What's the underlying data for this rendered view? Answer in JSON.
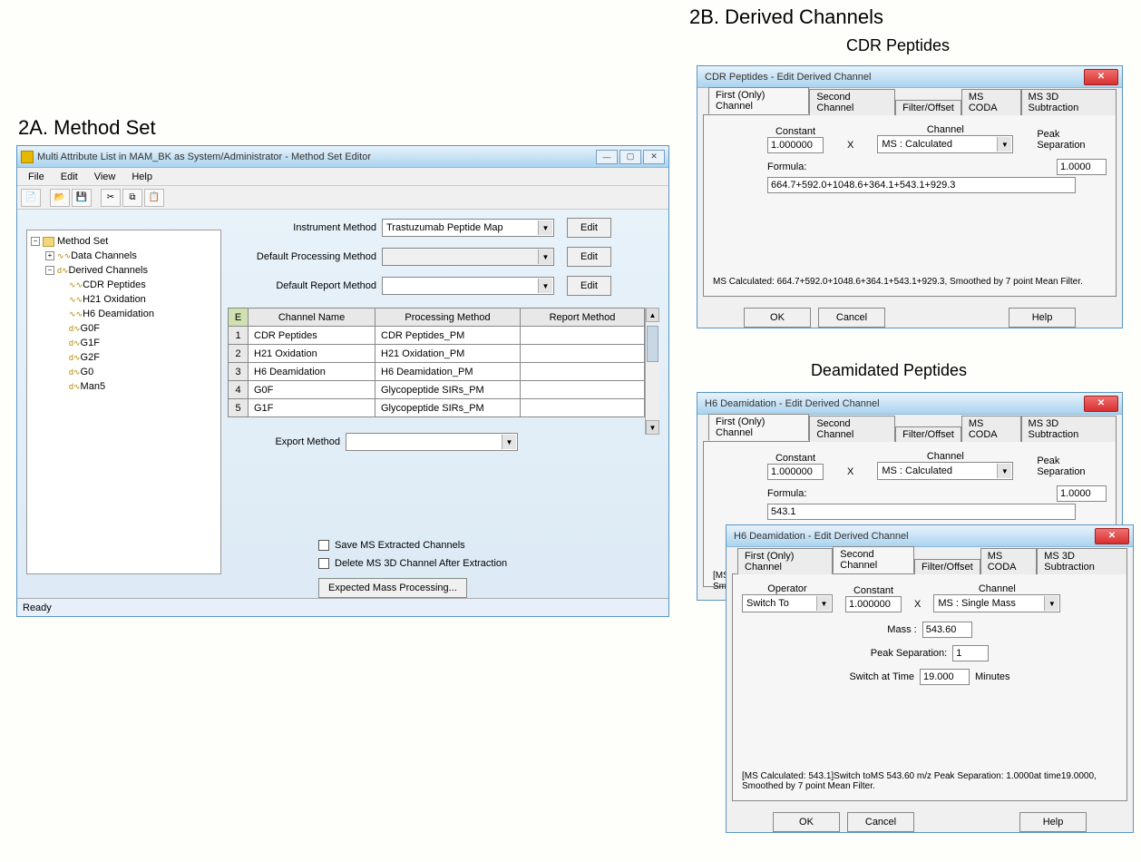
{
  "titles": {
    "sec2A": "2A. Method Set",
    "sec2B": "2B. Derived Channels",
    "sub_cdr": "CDR Peptides",
    "sub_deam": "Deamidated Peptides"
  },
  "window2A": {
    "title": "Multi Attribute List in MAM_BK as System/Administrator - Method Set Editor",
    "menu": {
      "file": "File",
      "edit": "Edit",
      "view": "View",
      "help": "Help"
    },
    "status": "Ready",
    "form": {
      "instrument_label": "Instrument Method",
      "instrument_value": "Trastuzumab Peptide Map",
      "processing_label": "Default Processing Method",
      "processing_value": "",
      "report_label": "Default Report Method",
      "report_value": "",
      "export_label": "Export Method",
      "export_value": "",
      "edit_btn": "Edit",
      "save_ms": "Save MS Extracted Channels",
      "delete_ms": "Delete MS 3D Channel After Extraction",
      "expected_mass": "Expected Mass Processing..."
    },
    "table": {
      "headers": {
        "ch": "Channel Name",
        "pm": "Processing Method",
        "rm": "Report Method"
      },
      "rows": [
        {
          "n": "1",
          "ch": "CDR Peptides",
          "pm": "CDR Peptides_PM",
          "rm": ""
        },
        {
          "n": "2",
          "ch": "H21 Oxidation",
          "pm": "H21 Oxidation_PM",
          "rm": ""
        },
        {
          "n": "3",
          "ch": "H6 Deamidation",
          "pm": "H6 Deamidation_PM",
          "rm": ""
        },
        {
          "n": "4",
          "ch": "G0F",
          "pm": "Glycopeptide SIRs_PM",
          "rm": ""
        },
        {
          "n": "5",
          "ch": "G1F",
          "pm": "Glycopeptide SIRs_PM",
          "rm": ""
        }
      ]
    },
    "tree": {
      "root": "Method Set",
      "data_channels": "Data Channels",
      "derived": "Derived Channels",
      "items": [
        "CDR Peptides",
        "H21 Oxidation",
        "H6 Deamidation",
        "G0F",
        "G1F",
        "G2F",
        "G0",
        "Man5"
      ]
    }
  },
  "dlg_cdr": {
    "title": "CDR Peptides - Edit Derived Channel",
    "tabs": [
      "First (Only) Channel",
      "Second Channel",
      "Filter/Offset",
      "MS CODA",
      "MS 3D Subtraction"
    ],
    "constant_label": "Constant",
    "constant": "1.000000",
    "x": "X",
    "channel_label": "Channel",
    "channel": "MS : Calculated",
    "peak_sep_label": "Peak Separation",
    "peak_sep": "1.0000",
    "formula_label": "Formula:",
    "formula": "664.7+592.0+1048.6+364.1+543.1+929.3",
    "note": "MS Calculated: 664.7+592.0+1048.6+364.1+543.1+929.3, Smoothed by 7 point Mean Filter.",
    "ok": "OK",
    "cancel": "Cancel",
    "help": "Help"
  },
  "dlg_deam1": {
    "title": "H6 Deamidation - Edit Derived Channel",
    "tabs": [
      "First (Only) Channel",
      "Second Channel",
      "Filter/Offset",
      "MS CODA",
      "MS 3D Subtraction"
    ],
    "constant_label": "Constant",
    "constant": "1.000000",
    "x": "X",
    "channel_label": "Channel",
    "channel": "MS : Calculated",
    "peak_sep_label": "Peak Separation",
    "peak_sep": "1.0000",
    "formula_label": "Formula:",
    "formula": "543.1",
    "note_prefix": "[MS",
    "note_prefix2": "Smo"
  },
  "dlg_deam2": {
    "title": "H6 Deamidation - Edit Derived Channel",
    "tabs": [
      "First (Only) Channel",
      "Second Channel",
      "Filter/Offset",
      "MS CODA",
      "MS 3D Subtraction"
    ],
    "operator_label": "Operator",
    "operator": "Switch To",
    "constant_label": "Constant",
    "constant": "1.000000",
    "x": "X",
    "channel_label": "Channel",
    "channel": "MS : Single Mass",
    "mass_label": "Mass :",
    "mass": "543.60",
    "peak_sep_label": "Peak Separation:",
    "peak_sep": "1",
    "switch_label": "Switch at Time",
    "switch": "19.000",
    "minutes": "Minutes",
    "note": "[MS Calculated: 543.1]Switch toMS 543.60 m/z Peak Separation: 1.0000at time19.0000, Smoothed by 7 point Mean Filter.",
    "ok": "OK",
    "cancel": "Cancel",
    "help": "Help"
  }
}
